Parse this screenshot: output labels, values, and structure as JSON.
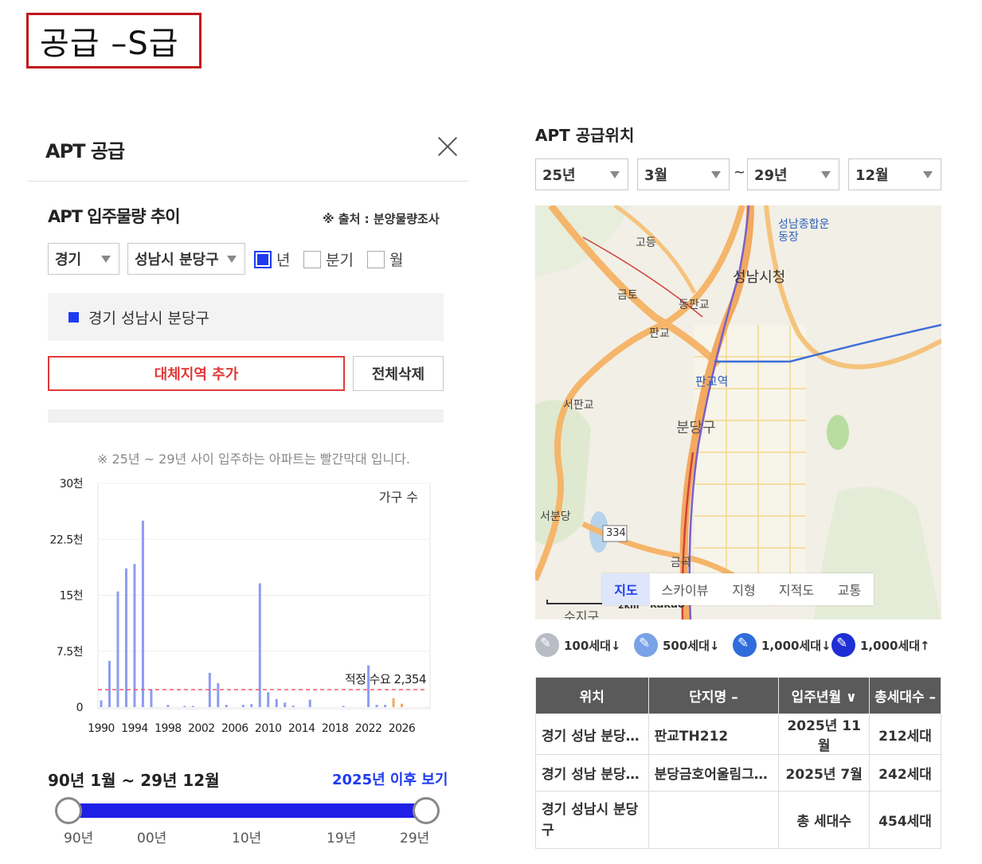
{
  "badge": {
    "text": "공급 –S급"
  },
  "left_panel": {
    "title": "APT 공급",
    "section_title": "APT 입주물량 추이",
    "source_note": "※ 출처 : 분양물량조사",
    "province_select": "경기",
    "district_select": "성남시 분당구",
    "period_options": [
      {
        "label": "년",
        "checked": true
      },
      {
        "label": "분기",
        "checked": false
      },
      {
        "label": "월",
        "checked": false
      }
    ],
    "region_label": "경기 성남시 분당구",
    "add_region_button": "대체지역 추가",
    "delete_all_button": "전체삭제",
    "chart_note": "※ 25년 ~ 29년 사이 입주하는 아파트는 빨간막대 입니다.",
    "range_title": "90년 1월 ~ 29년 12월",
    "range_link": "2025년 이후 보기",
    "slider_ticks": [
      "90년",
      "00년",
      "10년",
      "19년",
      "29년"
    ]
  },
  "chart_data": {
    "type": "bar",
    "series_label": "가구 수",
    "y_ticks": [
      "30천",
      "22.5천",
      "15천",
      "7.5천",
      "0"
    ],
    "x_ticks": [
      "1990",
      "1994",
      "1998",
      "2002",
      "2006",
      "2010",
      "2014",
      "2018",
      "2022",
      "2026"
    ],
    "ylim": [
      0,
      30000
    ],
    "xlim": [
      1990,
      2029
    ],
    "reference_line": {
      "label": "적정 수요 2,354",
      "value": 2354
    },
    "values": [
      {
        "x": 1990,
        "y": 900
      },
      {
        "x": 1991,
        "y": 6200
      },
      {
        "x": 1992,
        "y": 15500
      },
      {
        "x": 1993,
        "y": 18600
      },
      {
        "x": 1994,
        "y": 19200
      },
      {
        "x": 1995,
        "y": 25000
      },
      {
        "x": 1996,
        "y": 2400
      },
      {
        "x": 1998,
        "y": 300
      },
      {
        "x": 2000,
        "y": 150
      },
      {
        "x": 2001,
        "y": 150
      },
      {
        "x": 2003,
        "y": 4600
      },
      {
        "x": 2004,
        "y": 3200
      },
      {
        "x": 2005,
        "y": 300
      },
      {
        "x": 2007,
        "y": 300
      },
      {
        "x": 2008,
        "y": 400
      },
      {
        "x": 2009,
        "y": 16600
      },
      {
        "x": 2010,
        "y": 2000
      },
      {
        "x": 2011,
        "y": 1100
      },
      {
        "x": 2012,
        "y": 600
      },
      {
        "x": 2013,
        "y": 200
      },
      {
        "x": 2015,
        "y": 1000
      },
      {
        "x": 2019,
        "y": 150
      },
      {
        "x": 2022,
        "y": 5600
      },
      {
        "x": 2023,
        "y": 300
      },
      {
        "x": 2024,
        "y": 300
      },
      {
        "x": 2025,
        "y": 1200
      },
      {
        "x": 2026,
        "y": 450
      }
    ],
    "highlight_from": 2025
  },
  "right_panel": {
    "title": "APT 공급위치",
    "start_year": "25년",
    "start_month": "3월",
    "tilde": "~",
    "end_year": "29년",
    "end_month": "12월",
    "map_labels": [
      "고등",
      "성남종합운동장",
      "성남시청",
      "금토",
      "동판교",
      "판교",
      "판교역",
      "서판교",
      "분당구",
      "서분당",
      "334",
      "금곡",
      "수지구"
    ],
    "map_scale": "2km",
    "map_brand": "kakao",
    "map_tabs": [
      {
        "label": "지도",
        "active": true
      },
      {
        "label": "스카이뷰",
        "active": false
      },
      {
        "label": "지형",
        "active": false
      },
      {
        "label": "지적도",
        "active": false
      },
      {
        "label": "교통",
        "active": false
      }
    ],
    "legend": [
      {
        "label": "100세대↓",
        "color": "#b8bcc4"
      },
      {
        "label": "500세대↓",
        "color": "#7aa2e6"
      },
      {
        "label": "1,000세대↓",
        "color": "#2f6ddd"
      },
      {
        "label": "1,000세대↑",
        "color": "#1f2fd6"
      }
    ],
    "table": {
      "headers": [
        "위치",
        "단지명 –",
        "입주년월 ∨",
        "총세대수 –"
      ],
      "rows": [
        [
          "경기 성남 분당…",
          "판교TH212",
          "2025년 11월",
          "212세대"
        ],
        [
          "경기 성남 분당…",
          "분당금호어울림그…",
          "2025년 7월",
          "242세대"
        ]
      ],
      "total_row": {
        "location": "경기 성남시 분당구",
        "label": "총 세대수",
        "value": "454세대"
      }
    }
  }
}
